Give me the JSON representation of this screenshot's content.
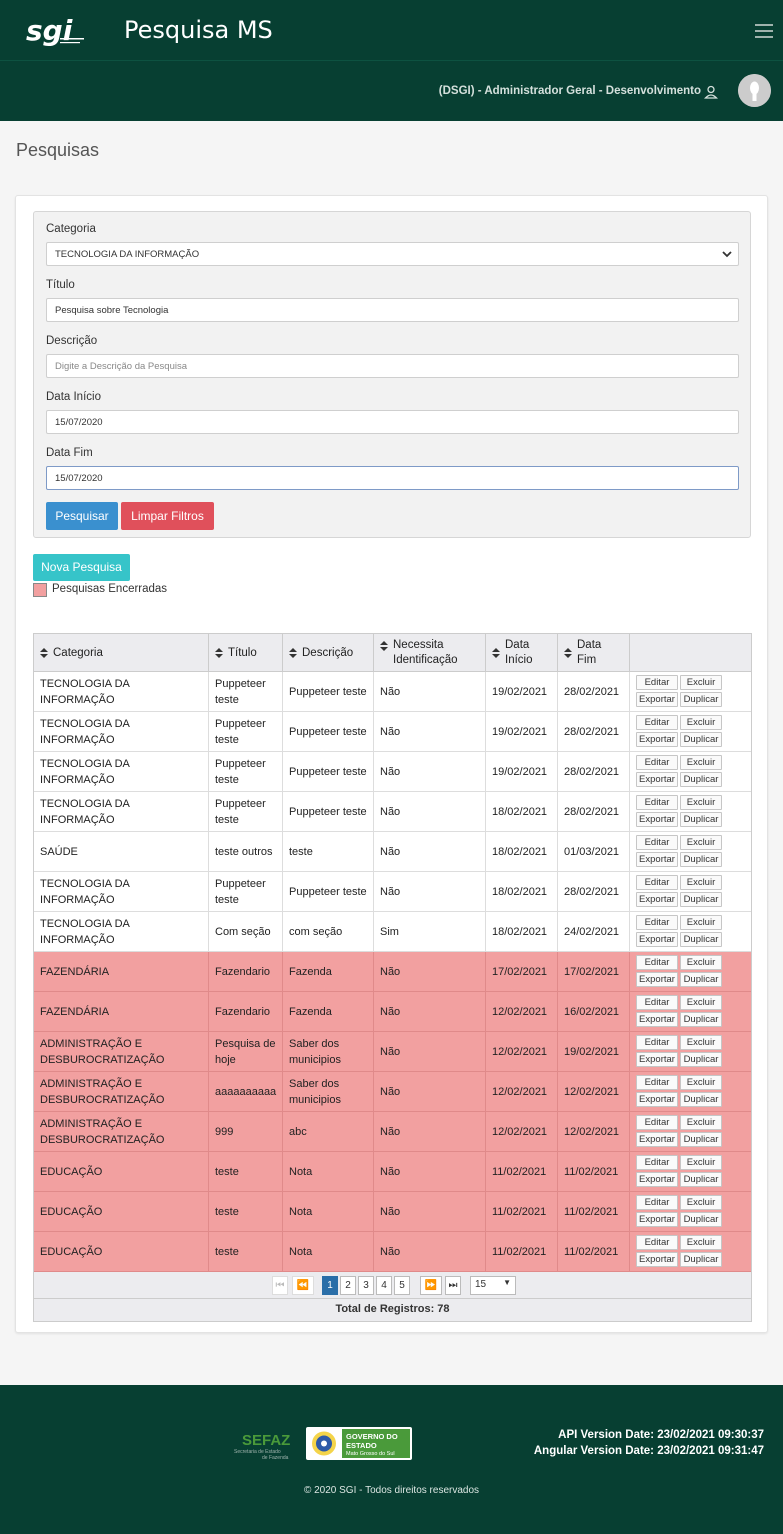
{
  "header": {
    "app_title": "Pesquisa MS",
    "user_name": "(DSGI) - Administrador Geral - Desenvolvimento",
    "logo_text": "SGI"
  },
  "page": {
    "title": "Pesquisas"
  },
  "filters": {
    "category_label": "Categoria",
    "category_value": "TECNOLOGIA DA INFORMAÇÃO",
    "title_label": "Título",
    "title_value": "Pesquisa sobre Tecnologia",
    "description_label": "Descrição",
    "description_placeholder": "Digite a Descrição da Pesquisa",
    "start_label": "Data Início",
    "start_value": "15/07/2020",
    "end_label": "Data Fim",
    "end_value": "15/07/2020",
    "search_button": "Pesquisar",
    "clear_button": "Limpar Filtros"
  },
  "new_button": "Nova Pesquisa",
  "legend": "Pesquisas Encerradas",
  "table": {
    "columns": [
      "Categoria",
      "Título",
      "Descrição",
      "Necessita Identificação",
      "Data Início",
      "Data Fim"
    ],
    "actions": [
      "Editar",
      "Excluir",
      "Exportar",
      "Duplicar"
    ],
    "rows": [
      {
        "categoria": "TECNOLOGIA DA INFORMAÇÃO",
        "titulo": "Puppeteer teste",
        "descricao": "Puppeteer teste",
        "ident": "Não",
        "inicio": "19/02/2021",
        "fim": "28/02/2021",
        "closed": false
      },
      {
        "categoria": "TECNOLOGIA DA INFORMAÇÃO",
        "titulo": "Puppeteer teste",
        "descricao": "Puppeteer teste",
        "ident": "Não",
        "inicio": "19/02/2021",
        "fim": "28/02/2021",
        "closed": false
      },
      {
        "categoria": "TECNOLOGIA DA INFORMAÇÃO",
        "titulo": "Puppeteer teste",
        "descricao": "Puppeteer teste",
        "ident": "Não",
        "inicio": "19/02/2021",
        "fim": "28/02/2021",
        "closed": false
      },
      {
        "categoria": "TECNOLOGIA DA INFORMAÇÃO",
        "titulo": "Puppeteer teste",
        "descricao": "Puppeteer teste",
        "ident": "Não",
        "inicio": "18/02/2021",
        "fim": "28/02/2021",
        "closed": false
      },
      {
        "categoria": "SAÚDE",
        "titulo": "teste outros",
        "descricao": "teste",
        "ident": "Não",
        "inicio": "18/02/2021",
        "fim": "01/03/2021",
        "closed": false
      },
      {
        "categoria": "TECNOLOGIA DA INFORMAÇÃO",
        "titulo": "Puppeteer teste",
        "descricao": "Puppeteer teste",
        "ident": "Não",
        "inicio": "18/02/2021",
        "fim": "28/02/2021",
        "closed": false
      },
      {
        "categoria": "TECNOLOGIA DA INFORMAÇÃO",
        "titulo": "Com seção",
        "descricao": "com seção",
        "ident": "Sim",
        "inicio": "18/02/2021",
        "fim": "24/02/2021",
        "closed": false
      },
      {
        "categoria": "FAZENDÁRIA",
        "titulo": "Fazendario",
        "descricao": "Fazenda",
        "ident": "Não",
        "inicio": "17/02/2021",
        "fim": "17/02/2021",
        "closed": true
      },
      {
        "categoria": "FAZENDÁRIA",
        "titulo": "Fazendario",
        "descricao": "Fazenda",
        "ident": "Não",
        "inicio": "12/02/2021",
        "fim": "16/02/2021",
        "closed": true
      },
      {
        "categoria": "ADMINISTRAÇÃO E DESBUROCRATIZAÇÃO",
        "titulo": "Pesquisa de hoje",
        "descricao": "Saber dos municipios",
        "ident": "Não",
        "inicio": "12/02/2021",
        "fim": "19/02/2021",
        "closed": true
      },
      {
        "categoria": "ADMINISTRAÇÃO E DESBUROCRATIZAÇÃO",
        "titulo": "aaaaaaaaaa",
        "descricao": "Saber dos municipios",
        "ident": "Não",
        "inicio": "12/02/2021",
        "fim": "12/02/2021",
        "closed": true
      },
      {
        "categoria": "ADMINISTRAÇÃO E DESBUROCRATIZAÇÃO",
        "titulo": "999",
        "descricao": "abc",
        "ident": "Não",
        "inicio": "12/02/2021",
        "fim": "12/02/2021",
        "closed": true
      },
      {
        "categoria": "EDUCAÇÃO",
        "titulo": "teste",
        "descricao": "Nota",
        "ident": "Não",
        "inicio": "11/02/2021",
        "fim": "11/02/2021",
        "closed": true
      },
      {
        "categoria": "EDUCAÇÃO",
        "titulo": "teste",
        "descricao": "Nota",
        "ident": "Não",
        "inicio": "11/02/2021",
        "fim": "11/02/2021",
        "closed": true
      },
      {
        "categoria": "EDUCAÇÃO",
        "titulo": "teste",
        "descricao": "Nota",
        "ident": "Não",
        "inicio": "11/02/2021",
        "fim": "11/02/2021",
        "closed": true
      }
    ]
  },
  "pagination": {
    "pages": [
      "1",
      "2",
      "3",
      "4",
      "5"
    ],
    "current": "1",
    "page_size": "15",
    "total": "Total de Registros: 78"
  },
  "footer": {
    "sefaz": "SEFAZ",
    "sefaz_sub": "Secretaria de Estado de Fazenda",
    "gov": "GOVERNO DO ESTADO",
    "gov_sub": "Mato Grosso do Sul",
    "api_version": "API Version Date: 23/02/2021 09:30:37",
    "angular_version": "Angular Version Date: 23/02/2021 09:31:47",
    "copyright": "© 2020 SGI - Todos direitos reservados"
  },
  "colors": {
    "header": "#073f32",
    "closed_row": "#f2a0a0",
    "primary": "#3a90cf",
    "danger": "#e0505b",
    "teal": "#36c4c9"
  }
}
